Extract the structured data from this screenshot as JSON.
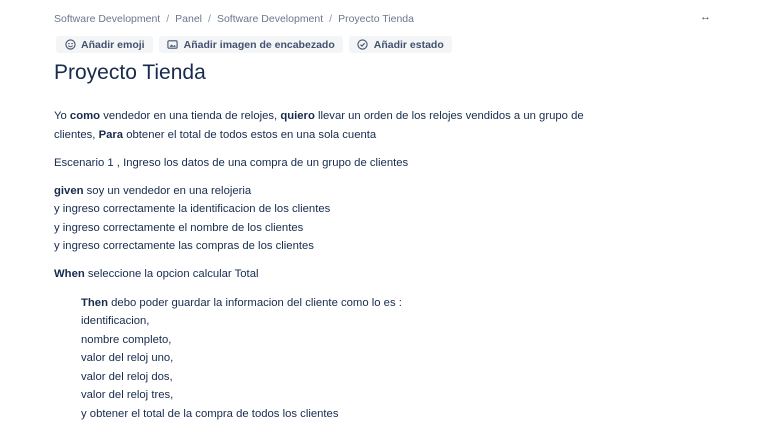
{
  "breadcrumb": [
    "Software Development",
    "Panel",
    "Software Development",
    "Proyecto Tienda"
  ],
  "header": {
    "expand_label": "↔",
    "actions": {
      "emoji": "Añadir emoji",
      "header_image": "Añadir imagen de encabezado",
      "status": "Añadir estado"
    }
  },
  "page": {
    "title": "Proyecto Tienda",
    "story": {
      "l1_a": "Yo ",
      "l1_b": "como",
      "l1_c": " vendedor en una tienda de relojes, ",
      "l1_d": "quiero",
      "l1_e": " llevar un orden de los relojes vendidos a un grupo de",
      "l2_a": "clientes, ",
      "l2_b": "Para",
      "l2_c": " obtener el total de todos estos en una sola cuenta"
    },
    "scenario": "Escenario 1 , Ingreso los datos de una compra de un grupo de clientes",
    "given": {
      "kw": "given",
      "text": " soy un vendedor en una relojeria",
      "and1": "y ingreso correctamente la identificacion de los clientes",
      "and2": "y ingreso correctamente el nombre de los clientes",
      "and3": "y ingreso correctamente las compras de los clientes"
    },
    "when": {
      "kw": "When",
      "text": " seleccione la opcion calcular Total"
    },
    "then": {
      "kw": "Then",
      "text": " debo poder guardar la informacion del cliente como lo es :",
      "items": [
        "identificacion,",
        "nombre completo,",
        "valor del reloj uno,",
        "valor del reloj dos,",
        "valor del reloj tres,",
        "y obtener el total de la compra de todos los clientes"
      ]
    }
  }
}
